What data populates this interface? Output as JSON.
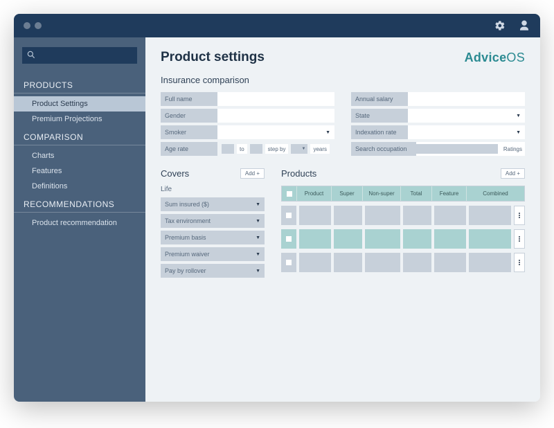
{
  "brand": {
    "part1": "Advice",
    "part2": "OS"
  },
  "sidebar": {
    "sections": [
      {
        "title": "PRODUCTS",
        "items": [
          {
            "label": "Product Settings",
            "active": true
          },
          {
            "label": "Premium Projections",
            "active": false
          }
        ]
      },
      {
        "title": "COMPARISON",
        "items": [
          {
            "label": "Charts"
          },
          {
            "label": "Features"
          },
          {
            "label": "Definitions"
          }
        ]
      },
      {
        "title": "RECOMMENDATIONS",
        "items": [
          {
            "label": "Product recommendation"
          }
        ]
      }
    ]
  },
  "page": {
    "title": "Product settings",
    "section_insurance": "Insurance comparison",
    "left_fields": {
      "full_name": "Full name",
      "gender": "Gender",
      "smoker": "Smoker",
      "age_rate": "Age rate",
      "to": "to",
      "step_by": "step by",
      "years": "years"
    },
    "right_fields": {
      "annual_salary": "Annual salary",
      "state": "State",
      "indexation_rate": "Indexation rate",
      "search_occupation": "Search occupation",
      "ratings": "Ratings"
    },
    "covers": {
      "title": "Covers",
      "add": "Add +",
      "life": "Life",
      "fields": [
        "Sum insured ($)",
        "Tax environment",
        "Premium basis",
        "Premium waiver",
        "Pay by rollover"
      ]
    },
    "products": {
      "title": "Products",
      "add": "Add +",
      "headers": [
        "Product",
        "Super",
        "Non-super",
        "Total",
        "Feature",
        "Combined"
      ]
    }
  }
}
